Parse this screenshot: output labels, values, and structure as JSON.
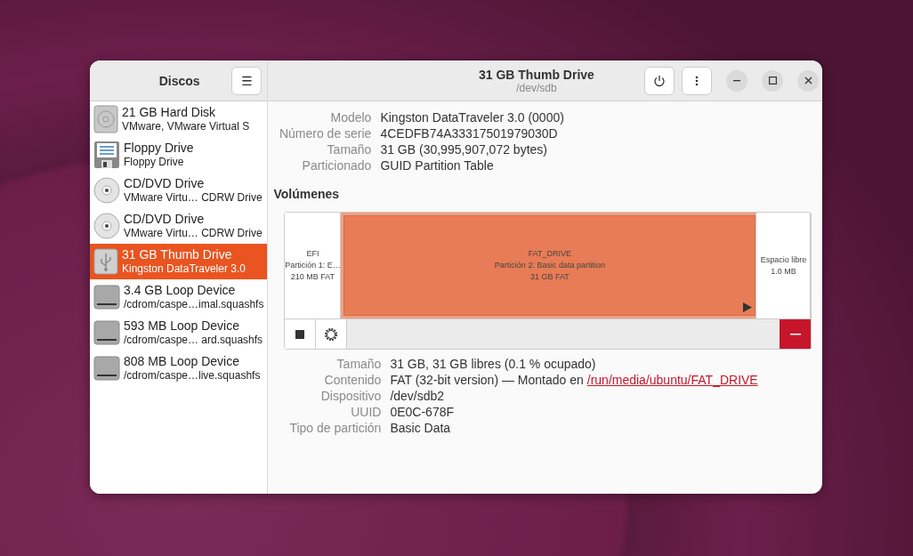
{
  "sidebar": {
    "title": "Discos",
    "menu_label": "☰",
    "drives": [
      {
        "kind": "harddisk",
        "name": "21 GB Hard Disk",
        "detail": "VMware, VMware Virtual S",
        "selected": false
      },
      {
        "kind": "floppy",
        "name": "Floppy Drive",
        "detail": "Floppy Drive",
        "selected": false
      },
      {
        "kind": "optical",
        "name": "CD/DVD Drive",
        "detail": "VMware Virtu… CDRW Drive",
        "selected": false
      },
      {
        "kind": "optical",
        "name": "CD/DVD Drive",
        "detail": "VMware Virtu… CDRW Drive",
        "selected": false
      },
      {
        "kind": "usb",
        "name": "31 GB Thumb Drive",
        "detail": "Kingston DataTraveler 3.0",
        "selected": true
      },
      {
        "kind": "loop",
        "name": "3.4 GB Loop Device",
        "detail": "/cdrom/caspe…imal.squashfs",
        "selected": false
      },
      {
        "kind": "loop",
        "name": "593 MB Loop Device",
        "detail": "/cdrom/caspe… ard.squashfs",
        "selected": false
      },
      {
        "kind": "loop",
        "name": "808 MB Loop Device",
        "detail": "/cdrom/caspe…live.squashfs",
        "selected": false
      }
    ]
  },
  "header": {
    "title": "31 GB Thumb Drive",
    "subtitle": "/dev/sdb"
  },
  "drive_info": [
    {
      "label": "Modelo",
      "value": "Kingston DataTraveler 3.0 (0000)"
    },
    {
      "label": "Número de serie",
      "value": "4CEDFB74A33317501979030D"
    },
    {
      "label": "Tamaño",
      "value": "31 GB (30,995,907,072 bytes)"
    },
    {
      "label": "Particionado",
      "value": "GUID Partition Table"
    }
  ],
  "volumes": {
    "title": "Volúmenes",
    "partitions": [
      {
        "kind": "partition",
        "lines": [
          "EFI",
          "Partición 1: E…",
          "210 MB FAT"
        ],
        "selected": false,
        "mounted": false
      },
      {
        "kind": "partition",
        "lines": [
          "FAT_DRIVE",
          "Partición 2: Basic data partition",
          "31 GB FAT"
        ],
        "selected": true,
        "mounted": true
      },
      {
        "kind": "free",
        "lines": [
          "Espacio libre",
          "1.0 MB"
        ],
        "selected": false,
        "mounted": false
      }
    ]
  },
  "volume_info": [
    {
      "label": "Tamaño",
      "value": "31 GB, 31 GB libres (0.1 % ocupado)"
    },
    {
      "label": "Contenido",
      "value": "FAT (32-bit version) — Montado en",
      "link": "/run/media/ubuntu/FAT_DRIVE"
    },
    {
      "label": "Dispositivo",
      "value": "/dev/sdb2"
    },
    {
      "label": "UUID",
      "value": "0E0C-678F"
    },
    {
      "label": "Tipo de partición",
      "value": "Basic Data"
    }
  ]
}
